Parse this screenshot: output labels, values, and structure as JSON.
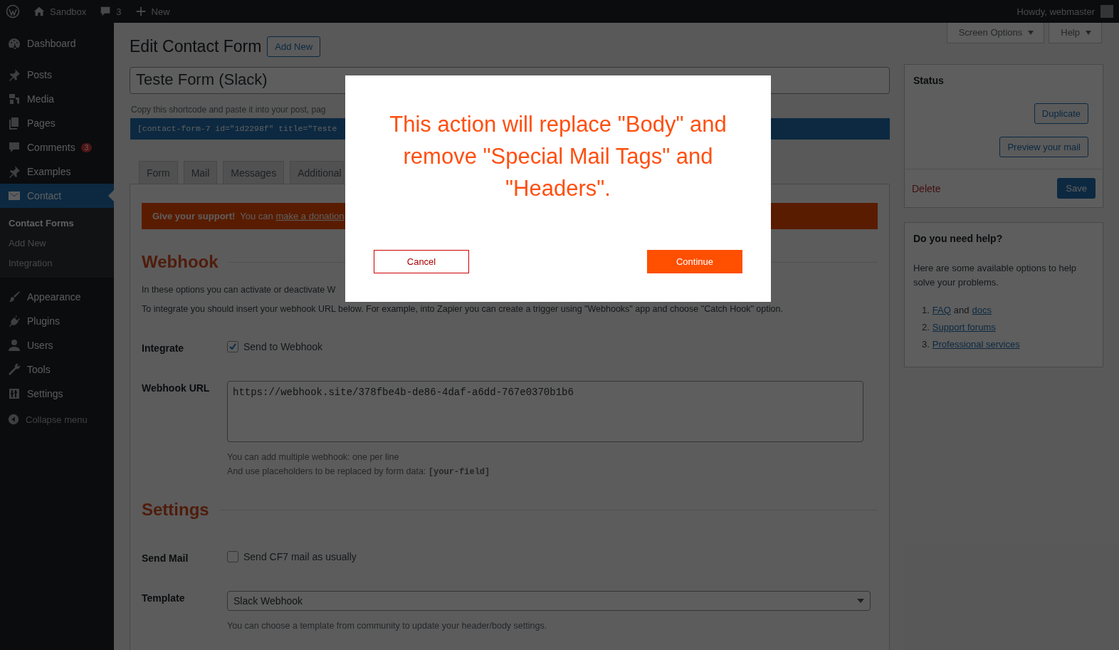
{
  "admin_bar": {
    "site": "Sandbox",
    "comments": "3",
    "new": "New",
    "greeting": "Howdy, webmaster"
  },
  "sidebar": {
    "items": [
      {
        "label": "Dashboard",
        "selected": false
      },
      {
        "label": "Posts",
        "selected": false
      },
      {
        "label": "Media",
        "selected": false
      },
      {
        "label": "Pages",
        "selected": false
      },
      {
        "label": "Comments",
        "badge": "3",
        "selected": false
      },
      {
        "label": "Examples",
        "selected": false
      },
      {
        "label": "Contact",
        "selected": true,
        "children": [
          {
            "label": "Contact Forms",
            "selected": true
          },
          {
            "label": "Add New",
            "selected": false
          },
          {
            "label": "Integration",
            "selected": false
          }
        ]
      },
      {
        "label": "Appearance",
        "selected": false
      },
      {
        "label": "Plugins",
        "selected": false
      },
      {
        "label": "Users",
        "selected": false
      },
      {
        "label": "Tools",
        "selected": false
      },
      {
        "label": "Settings",
        "selected": false
      }
    ],
    "collapse": "Collapse menu"
  },
  "screen_meta": [
    "Screen Options",
    "Help"
  ],
  "page": {
    "title": "Edit Contact Form",
    "add_new": "Add New",
    "form_title": "Teste Form (Slack)",
    "shortcode_hint": "Copy this shortcode and paste it into your post, pag",
    "shortcode": "[contact-form-7 id=\"1d2298f\" title=\"Teste",
    "tabs": [
      {
        "label": "Form",
        "selected": false
      },
      {
        "label": "Mail",
        "selected": false
      },
      {
        "label": "Messages",
        "selected": false
      },
      {
        "label": "Additional",
        "selected": false
      }
    ],
    "banner": {
      "lead": "Give your support!",
      "text": "You can",
      "link": "make a donation"
    },
    "sections": [
      {
        "heading": "Webhook",
        "intro": [
          "In these options you can activate or deactivate W",
          "To integrate you should insert your webhook URL below. For example, into Zapier you can create a trigger using \"Webhooks\" app and choose \"Catch Hook\" option."
        ],
        "fields": [
          {
            "kind": "checkbox",
            "label": "Integrate",
            "text": "Send to Webhook",
            "checked": true
          },
          {
            "kind": "textarea",
            "label": "Webhook URL",
            "value": "https://webhook.site/378fbe4b-de86-4daf-a6dd-767e0370b1b6",
            "hints": [
              {
                "text": "You can add multiple webhook: one per line"
              },
              {
                "text": "And use placeholders to be replaced by form data:",
                "code": "[your-field]"
              }
            ]
          }
        ]
      },
      {
        "heading": "Settings",
        "fields": [
          {
            "kind": "checkbox",
            "label": "Send Mail",
            "text": "Send CF7 mail as usually",
            "checked": false
          },
          {
            "kind": "select",
            "label": "Template",
            "value": "Slack Webhook",
            "hints": [
              {
                "text": "You can choose a template from community to update your header/body settings."
              }
            ]
          }
        ]
      }
    ]
  },
  "status_box": {
    "title": "Status",
    "duplicate": "Duplicate",
    "preview": "Preview your mail",
    "delete": "Delete",
    "save": "Save"
  },
  "help_box": {
    "title": "Do you need help?",
    "text": "Here are some available options to help solve your problems.",
    "items": [
      {
        "number": "1.",
        "parts": [
          {
            "text": "FAQ",
            "kind": "link"
          },
          {
            "text": "and",
            "kind": "text"
          },
          {
            "text": "docs",
            "kind": "link"
          }
        ]
      },
      {
        "number": "2.",
        "parts": [
          {
            "text": "Support forums",
            "kind": "link"
          }
        ]
      },
      {
        "number": "3.",
        "parts": [
          {
            "text": "Professional services",
            "kind": "link"
          }
        ]
      }
    ]
  },
  "modal": {
    "message": "This action will replace \"Body\" and remove \"Special Mail Tags\" and \"Headers\".",
    "cancel": "Cancel",
    "continue": "Continue"
  }
}
